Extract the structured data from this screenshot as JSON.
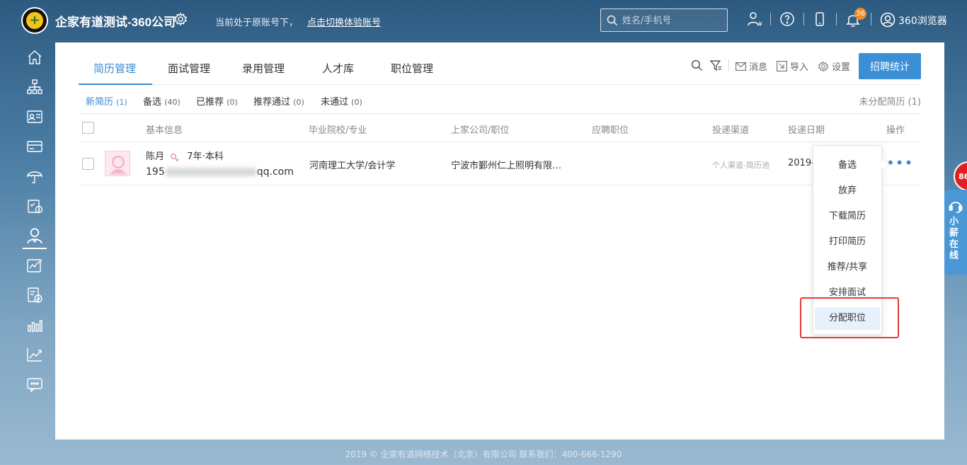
{
  "header": {
    "company_name": "企家有道测试-360公司",
    "notice": "当前处于原账号下，",
    "switch_link": "点击切换体验账号",
    "search_placeholder": "姓名/手机号",
    "notification_count": "36",
    "browser_label": "360浏览器"
  },
  "tabs": [
    {
      "label": "简历管理",
      "active": true
    },
    {
      "label": "面试管理"
    },
    {
      "label": "录用管理"
    },
    {
      "label": "人才库"
    },
    {
      "label": "职位管理"
    }
  ],
  "toolbar": {
    "message": "消息",
    "import": "导入",
    "settings": "设置",
    "stats_button": "招聘统计"
  },
  "subtabs": [
    {
      "label": "新简历",
      "count": "(1)",
      "active": true
    },
    {
      "label": "备选",
      "count": "(40)"
    },
    {
      "label": "已推荐",
      "count": "(0)"
    },
    {
      "label": "推荐通过",
      "count": "(0)"
    },
    {
      "label": "未通过",
      "count": "(0)"
    }
  ],
  "unassigned": "未分配简历 (1)",
  "table": {
    "headers": [
      "基本信息",
      "毕业院校/专业",
      "上家公司/职位",
      "应聘职位",
      "投递渠道",
      "投递日期",
      "操作"
    ],
    "rows": [
      {
        "name": "陈月",
        "experience": "7年·本科",
        "email_prefix": "195",
        "email_suffix": "qq.com",
        "school": "河南理工大学/会计学",
        "company": "宁波市鄞州仁上照明有限…",
        "position": "",
        "channel": "个人渠道-简历池",
        "date": "2019-"
      }
    ]
  },
  "dropdown": [
    {
      "label": "备选"
    },
    {
      "label": "放弃"
    },
    {
      "label": "下载简历"
    },
    {
      "label": "打印简历"
    },
    {
      "label": "推荐/共享"
    },
    {
      "label": "安排面试"
    },
    {
      "label": "分配职位",
      "highlighted": true
    }
  ],
  "side_widgets": {
    "red_badge": "86",
    "chat_label": "小薪在线"
  },
  "footer": "2019 © 企家有道网络技术（北京）有限公司   联系我们：400-666-1290",
  "colors": {
    "accent": "#3a8ad0",
    "button": "#3b8fd5",
    "highlight_box": "#e23b3b",
    "badge": "#f08a24"
  },
  "icons": [
    "home-icon",
    "org-chart-icon",
    "id-card-icon",
    "card-icon",
    "umbrella-icon",
    "calendar-check-icon",
    "person-icon",
    "chart-edit-icon",
    "doc-check-icon",
    "bar-chart-icon",
    "trend-icon",
    "chat-icon"
  ]
}
